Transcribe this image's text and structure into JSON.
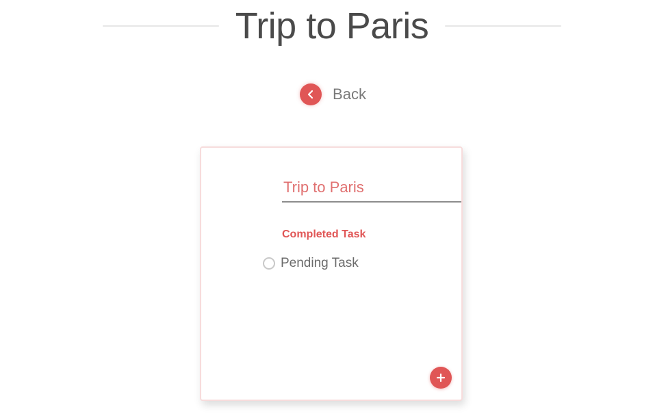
{
  "header": {
    "title": "Trip to Paris"
  },
  "back": {
    "label": "Back",
    "icon": "chevron-left-icon"
  },
  "card": {
    "title_value": "Trip to Paris",
    "completed_label": "Completed Task",
    "tasks": [
      {
        "label": "Pending Task",
        "checked": false
      }
    ],
    "fab_icon": "plus-icon"
  },
  "colors": {
    "accent": "#e05656",
    "title_text": "#4a4a4a",
    "input_text": "#e07070",
    "card_border": "#f7dcdc"
  }
}
